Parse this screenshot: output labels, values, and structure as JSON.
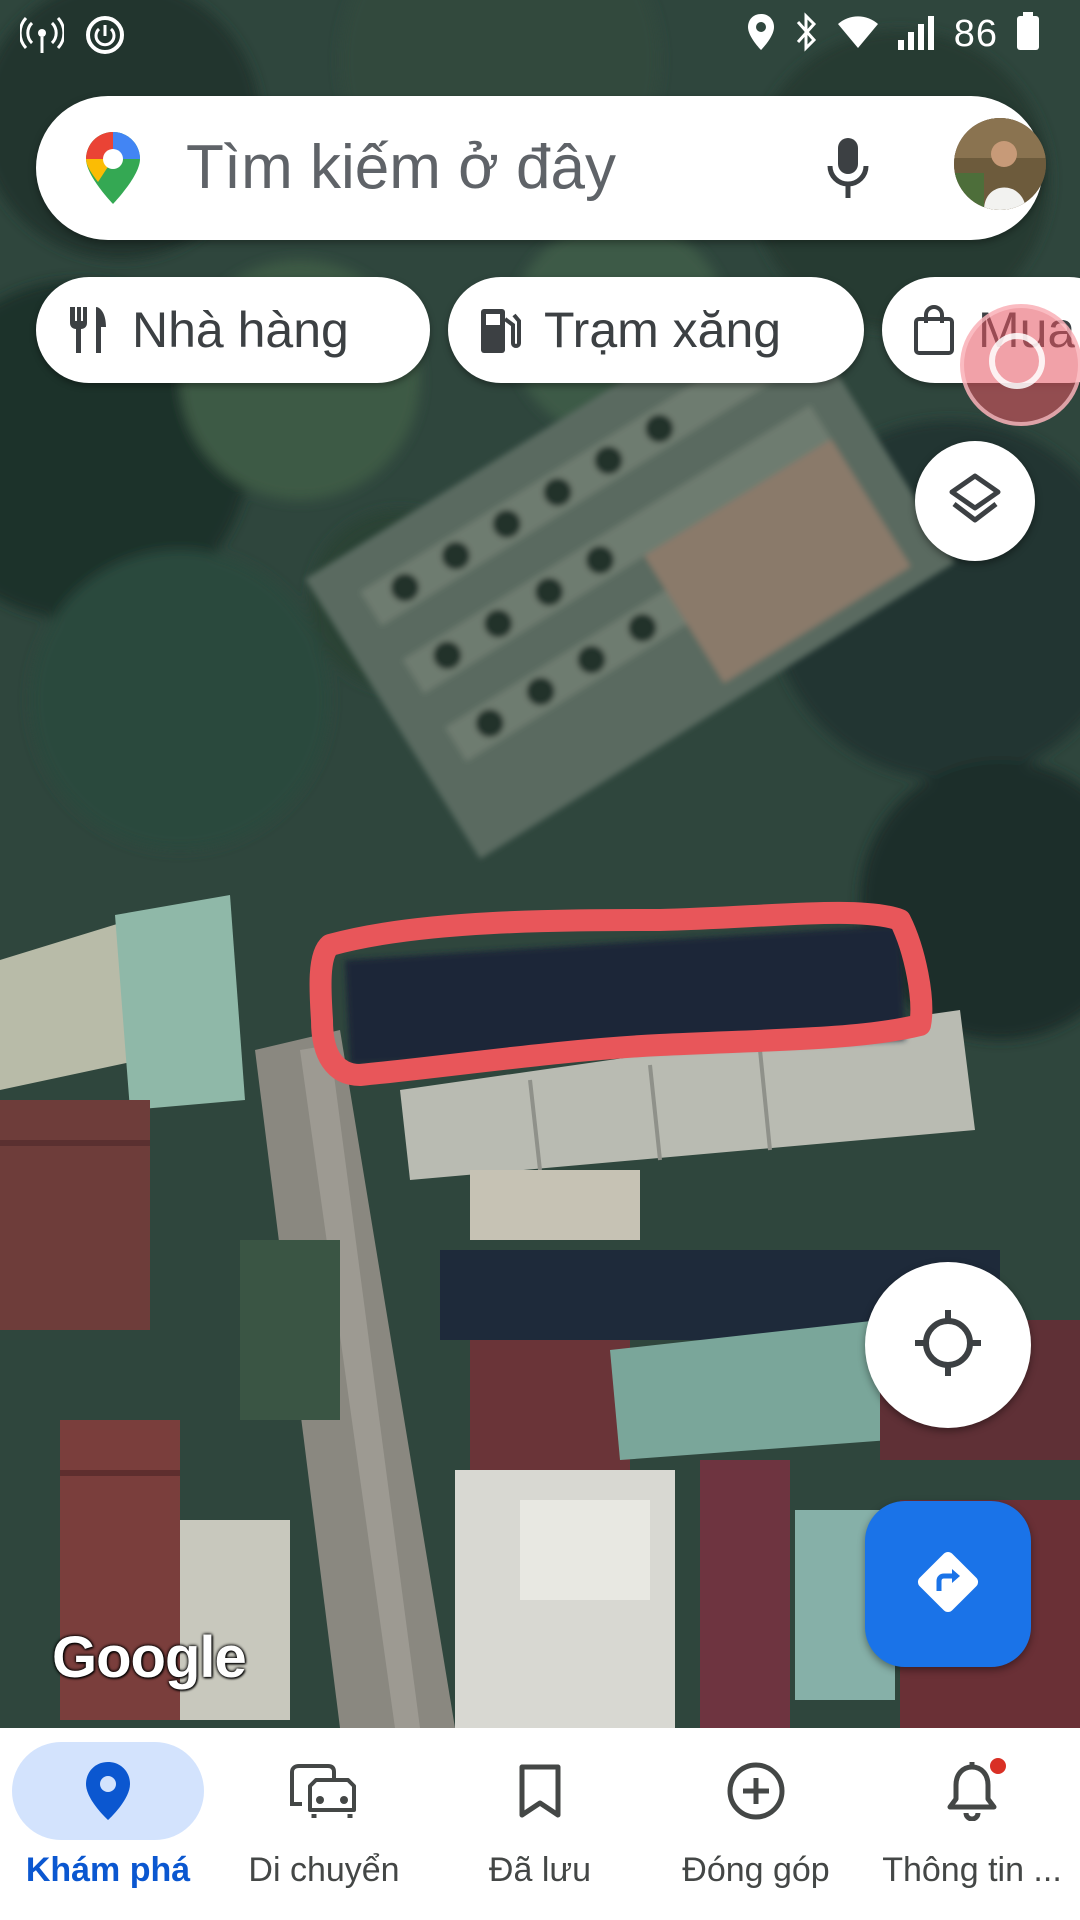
{
  "status_bar": {
    "battery_text": "86",
    "icons": [
      "hotspot-icon",
      "power-icon",
      "location-icon",
      "bluetooth-icon",
      "wifi-icon",
      "signal-icon",
      "battery-icon"
    ]
  },
  "search": {
    "placeholder": "Tìm kiếm ở đây",
    "logo": "google-maps-pin-logo",
    "mic_icon": "mic-icon",
    "avatar": "profile-avatar"
  },
  "chips": [
    {
      "label": "Nhà hàng",
      "icon": "restaurant-icon"
    },
    {
      "label": "Trạm xăng",
      "icon": "gas-station-icon"
    },
    {
      "label": "Mua",
      "icon": "shopping-bag-icon"
    }
  ],
  "map": {
    "watermark": "Google",
    "view": "satellite",
    "annotation": "red-hand-drawn-outline",
    "annotation_color": "#e8565a"
  },
  "buttons": {
    "layers_icon": "layers-icon",
    "locate_icon": "my-location-icon",
    "directions_icon": "directions-icon"
  },
  "bottom_nav": {
    "items": [
      {
        "label": "Khám phá",
        "icon": "explore-pin-icon",
        "active": true
      },
      {
        "label": "Di chuyển",
        "icon": "commute-icon",
        "active": false
      },
      {
        "label": "Đã lưu",
        "icon": "bookmark-icon",
        "active": false
      },
      {
        "label": "Đóng góp",
        "icon": "add-circle-icon",
        "active": false
      },
      {
        "label": "Thông tin ...",
        "icon": "bell-icon",
        "active": false
      }
    ]
  },
  "colors": {
    "accent": "#1a73e8",
    "active_pill": "#d3e3fd",
    "active_label": "#0b57d0",
    "notification_dot": "#d93025"
  }
}
